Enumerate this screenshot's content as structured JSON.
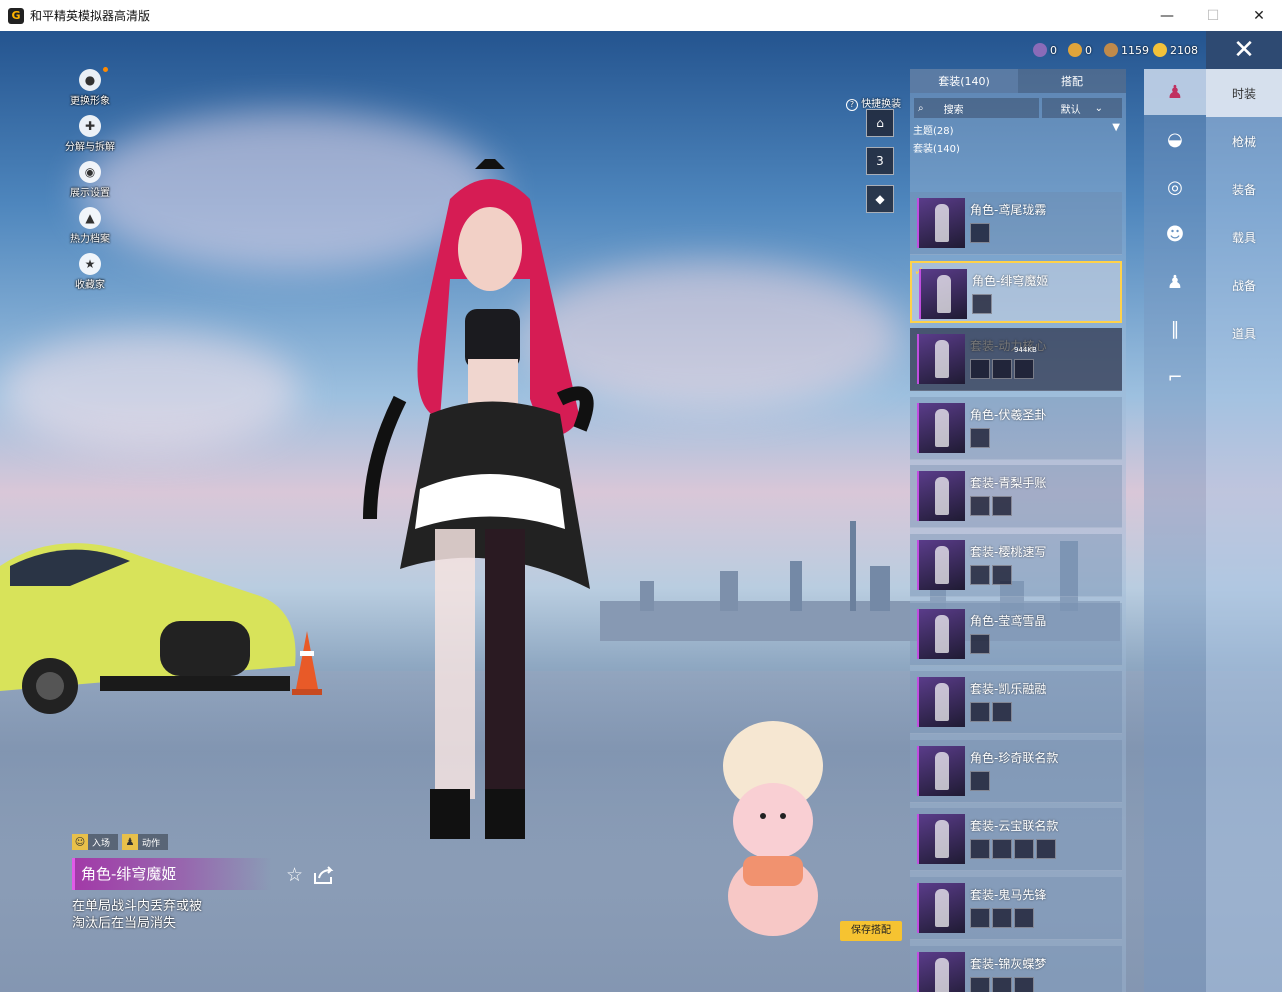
{
  "window": {
    "title": "和平精英模拟器高清版",
    "app_icon": "G",
    "controls": [
      "—",
      "☐",
      "✕"
    ]
  },
  "currency": [
    {
      "value": "0",
      "color": "#8a6bb8"
    },
    {
      "value": "0",
      "color": "#e0a43a"
    },
    {
      "value": "1159",
      "color": "#c08a4a"
    },
    {
      "value": "2108",
      "color": "#f3c23a"
    }
  ],
  "left_menu": [
    {
      "label": "更换形象",
      "icon": "person-icon"
    },
    {
      "label": "分解与拆解",
      "icon": "puzzle-icon"
    },
    {
      "label": "展示设置",
      "icon": "eye-icon"
    },
    {
      "label": "热力档案",
      "icon": "flame-icon"
    },
    {
      "label": "收藏家",
      "icon": "medal-icon"
    }
  ],
  "quick_swap": {
    "label": "快捷换装",
    "help": "?",
    "slot2_num": "3"
  },
  "animation_tabs": [
    "入场",
    "动作"
  ],
  "selected_item": {
    "name": "角色-绯穹魔姬",
    "description_line1": "在单局战斗内丢弃或被",
    "description_line2": "淘汰后在当局消失"
  },
  "save_button": "保存搭配",
  "list_tabs": [
    "套装(140)",
    "搭配"
  ],
  "search": {
    "placeholder": "搜索",
    "sort": "默认"
  },
  "theme_label": "主题(28)",
  "suit_label": "套装(140)",
  "items": [
    {
      "name": "角色-鸢尾珑霧",
      "subs": 1,
      "state": "normal"
    },
    {
      "name": "角色-绯穹魔姬",
      "subs": 1,
      "state": "selected"
    },
    {
      "name": "套装-动力核心",
      "subs": 3,
      "state": "dim",
      "download": "944KB"
    },
    {
      "name": "角色-伏羲圣卦",
      "subs": 1,
      "state": "normal"
    },
    {
      "name": "套装-青梨手账",
      "subs": 2,
      "state": "normal"
    },
    {
      "name": "套装-樱桃速写",
      "subs": 2,
      "state": "normal"
    },
    {
      "name": "角色-莹鸢雪晶",
      "subs": 1,
      "state": "normal"
    },
    {
      "name": "套装-凯乐融融",
      "subs": 2,
      "state": "normal"
    },
    {
      "name": "角色-珍奇联名款",
      "subs": 1,
      "state": "normal"
    },
    {
      "name": "套装-云宝联名款",
      "subs": 4,
      "state": "normal"
    },
    {
      "name": "套装-鬼马先锋",
      "subs": 3,
      "state": "normal"
    },
    {
      "name": "套装-锦灰蝶梦",
      "subs": 3,
      "state": "normal"
    }
  ],
  "category_icons": [
    "outfit-icon",
    "hat-icon",
    "goggles-icon",
    "mask-icon",
    "top-icon",
    "pants-icon",
    "shoes-icon"
  ],
  "main_tabs": [
    {
      "label": "时装",
      "active": true
    },
    {
      "label": "枪械",
      "active": false
    },
    {
      "label": "装备",
      "active": false
    },
    {
      "label": "载具",
      "active": false
    },
    {
      "label": "战备",
      "active": false
    },
    {
      "label": "道具",
      "active": false
    }
  ]
}
